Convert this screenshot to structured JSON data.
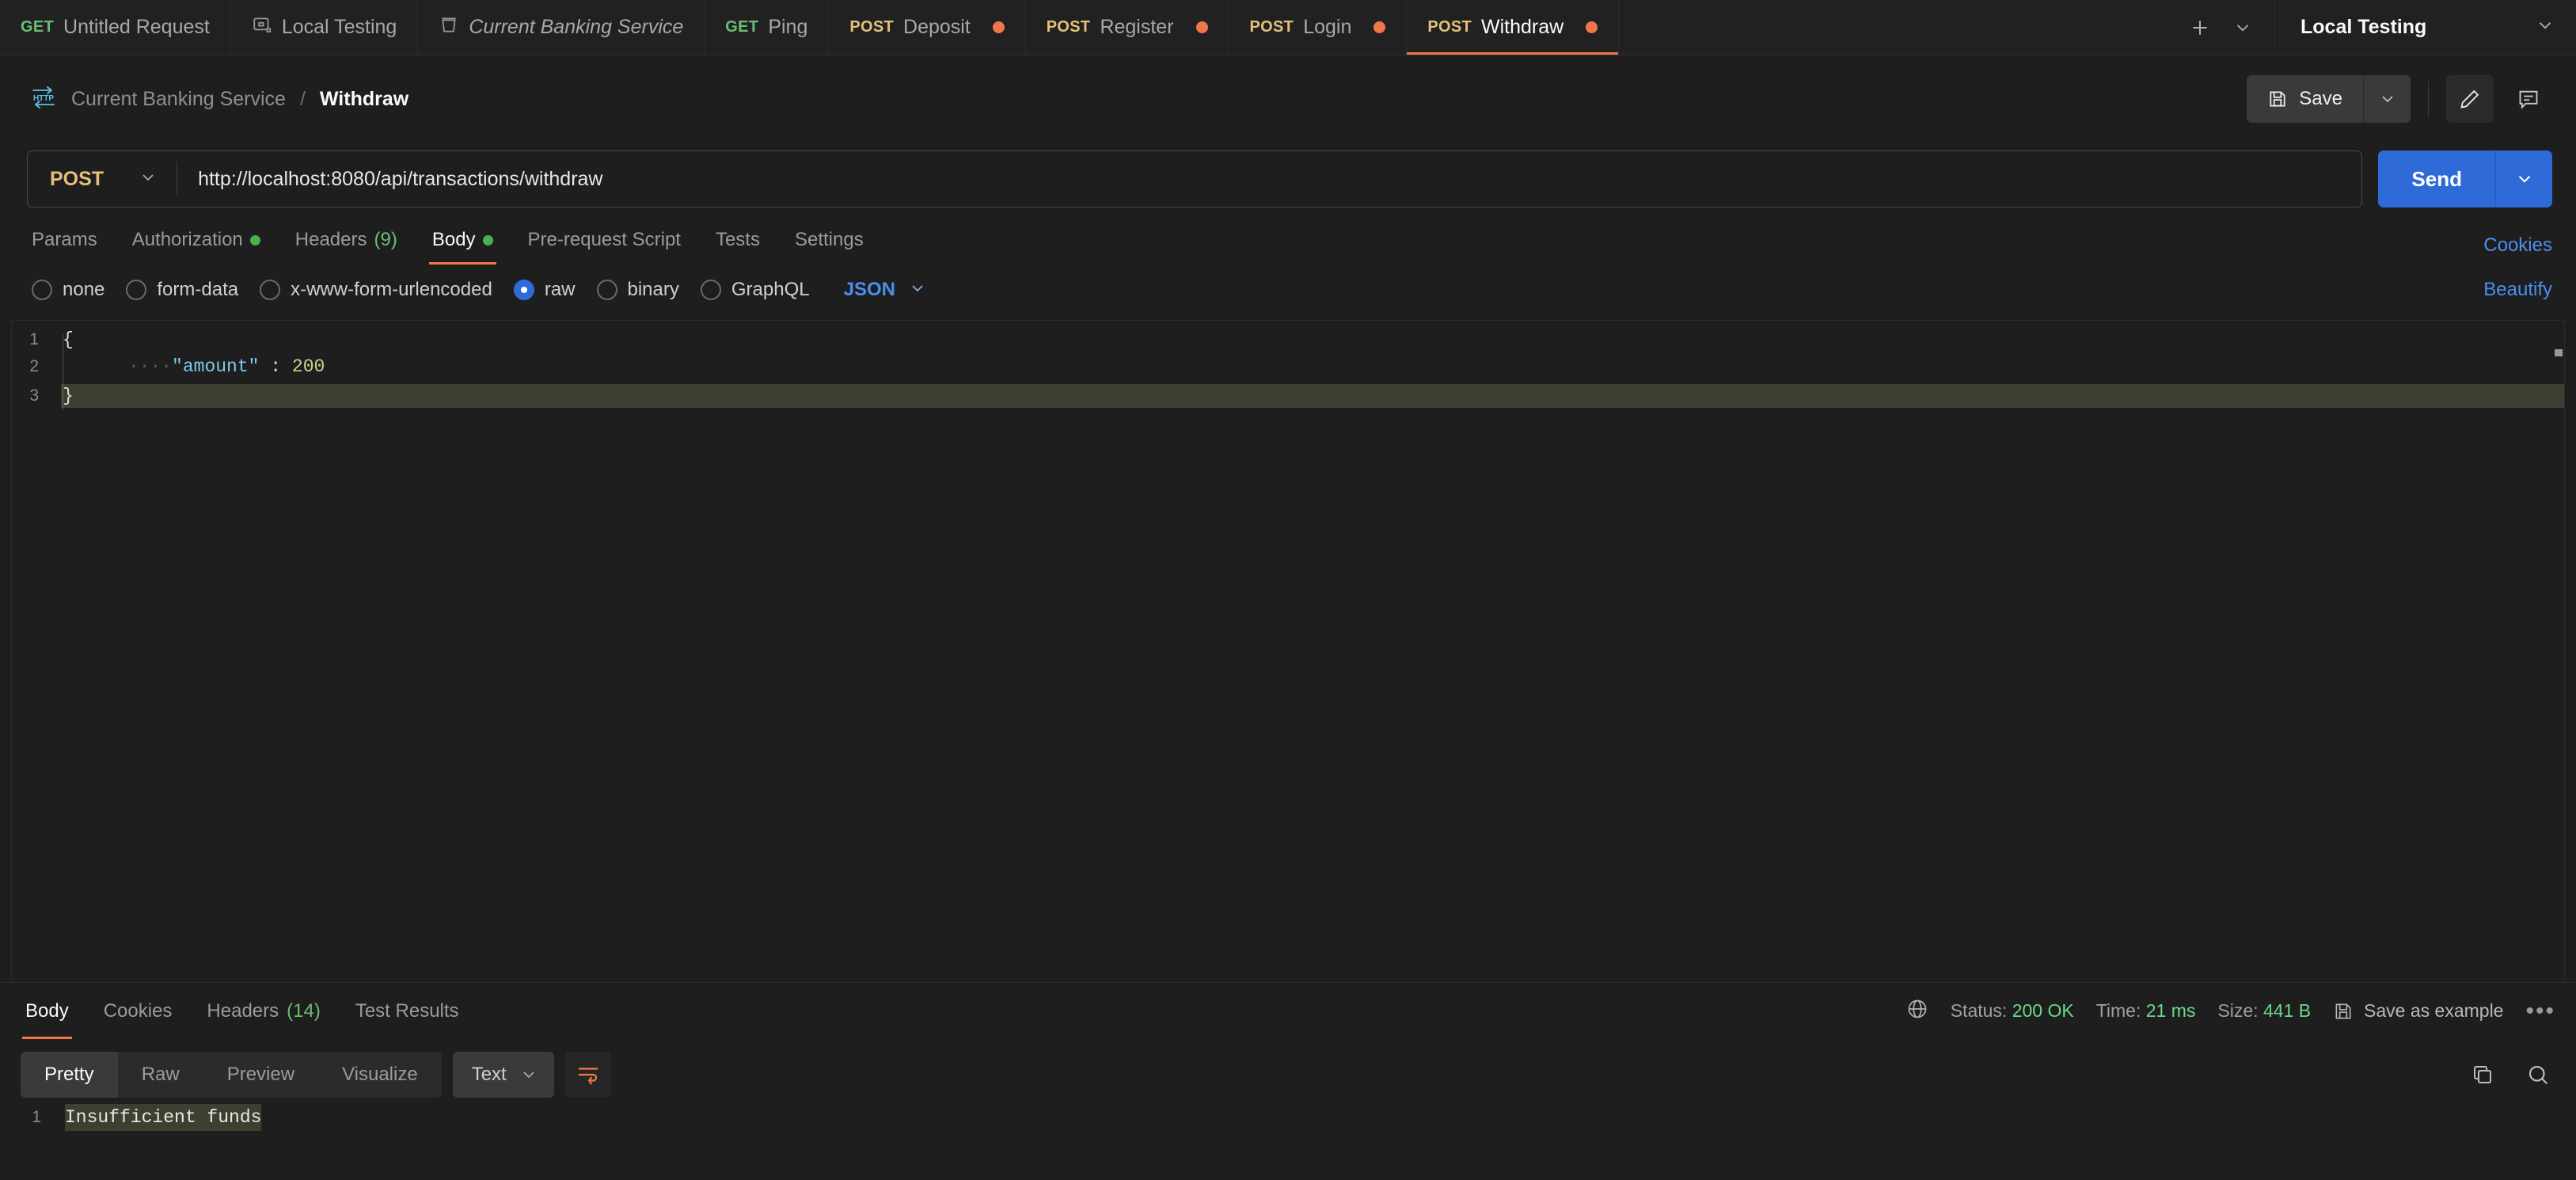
{
  "tabbar": {
    "tabs": [
      {
        "method": "GET",
        "method_class": "m-get",
        "label": "Untitled Request",
        "icon": "",
        "dot": false,
        "active": false,
        "italic": false
      },
      {
        "method": "",
        "method_class": "",
        "label": "Local Testing",
        "icon": "environment-icon",
        "dot": false,
        "active": false,
        "italic": false
      },
      {
        "method": "",
        "method_class": "",
        "label": "Current Banking Service",
        "icon": "collection-icon",
        "dot": false,
        "active": false,
        "italic": true
      },
      {
        "method": "GET",
        "method_class": "m-get",
        "label": "Ping",
        "icon": "",
        "dot": false,
        "active": false,
        "italic": false
      },
      {
        "method": "POST",
        "method_class": "m-post",
        "label": "Deposit",
        "icon": "",
        "dot": true,
        "active": false,
        "italic": false
      },
      {
        "method": "POST",
        "method_class": "m-post",
        "label": "Register",
        "icon": "",
        "dot": true,
        "active": false,
        "italic": false
      },
      {
        "method": "POST",
        "method_class": "m-post",
        "label": "Login",
        "icon": "",
        "dot": true,
        "active": false,
        "italic": false
      },
      {
        "method": "POST",
        "method_class": "m-post",
        "label": "Withdraw",
        "icon": "",
        "dot": true,
        "active": true,
        "italic": false
      }
    ],
    "new_tab_label": "+",
    "environment": "Local Testing"
  },
  "breadcrumb": {
    "icon": "http-icon",
    "collection": "Current Banking Service",
    "separator": "/",
    "current": "Withdraw",
    "save_label": "Save"
  },
  "request": {
    "method": "POST",
    "url": "http://localhost:8080/api/transactions/withdraw",
    "send_label": "Send",
    "tabs": [
      {
        "label": "Params",
        "dot": false,
        "count": "",
        "active": false
      },
      {
        "label": "Authorization",
        "dot": true,
        "count": "",
        "active": false
      },
      {
        "label": "Headers",
        "dot": false,
        "count": "(9)",
        "active": false
      },
      {
        "label": "Body",
        "dot": true,
        "count": "",
        "active": true
      },
      {
        "label": "Pre-request Script",
        "dot": false,
        "count": "",
        "active": false
      },
      {
        "label": "Tests",
        "dot": false,
        "count": "",
        "active": false
      },
      {
        "label": "Settings",
        "dot": false,
        "count": "",
        "active": false
      }
    ],
    "cookies_link": "Cookies",
    "beautify_link": "Beautify",
    "body_types": [
      {
        "label": "none",
        "checked": false
      },
      {
        "label": "form-data",
        "checked": false
      },
      {
        "label": "x-www-form-urlencoded",
        "checked": false
      },
      {
        "label": "raw",
        "checked": true
      },
      {
        "label": "binary",
        "checked": false
      },
      {
        "label": "GraphQL",
        "checked": false
      }
    ],
    "raw_format": "JSON",
    "body_lines": [
      {
        "num": "1",
        "text": "{"
      },
      {
        "num": "2",
        "text": "    \"amount\" : 200"
      },
      {
        "num": "3",
        "text": "}"
      }
    ],
    "body_tokens": {
      "line1": "{",
      "line2_dots": "····",
      "line2_key": "\"amount\"",
      "line2_colon": " : ",
      "line2_value": "200",
      "line3": "}"
    }
  },
  "response": {
    "tabs": [
      {
        "label": "Body",
        "count": "",
        "active": true
      },
      {
        "label": "Cookies",
        "count": "",
        "active": false
      },
      {
        "label": "Headers",
        "count": "(14)",
        "active": false
      },
      {
        "label": "Test Results",
        "count": "",
        "active": false
      }
    ],
    "status_label": "Status:",
    "status_value": "200 OK",
    "time_label": "Time:",
    "time_value": "21 ms",
    "size_label": "Size:",
    "size_value": "441 B",
    "save_example": "Save as example",
    "more": "•••",
    "view_modes": [
      {
        "label": "Pretty",
        "active": true
      },
      {
        "label": "Raw",
        "active": false
      },
      {
        "label": "Preview",
        "active": false
      },
      {
        "label": "Visualize",
        "active": false
      }
    ],
    "content_type": "Text",
    "body_lines": [
      {
        "num": "1",
        "text": "Insufficient funds"
      }
    ]
  },
  "colors": {
    "accent_orange": "#f2764c",
    "send_blue": "#2f6ad9",
    "link_blue": "#4a8ff0",
    "green": "#6bd98a",
    "method_post": "#e6c07b",
    "method_get": "#6bbf73",
    "bg": "#1e1e1e"
  }
}
